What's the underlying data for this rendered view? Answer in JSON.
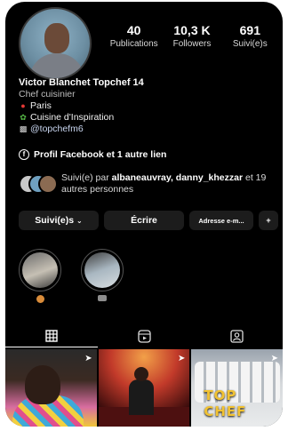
{
  "profile": {
    "name": "Victor Blanchet Topchef 14",
    "category": "Chef cuisinier",
    "location": "Paris",
    "tagline": "Cuisine d'Inspiration",
    "handle": "@topchefm6"
  },
  "stats": [
    {
      "value": "40",
      "label": "Publications"
    },
    {
      "value": "10,3 K",
      "label": "Followers"
    },
    {
      "value": "691",
      "label": "Suivi(e)s"
    }
  ],
  "links": {
    "facebook": "Profil Facebook et 1 autre lien"
  },
  "followed_by": {
    "prefix": "Suivi(e) par ",
    "names": "albaneauvray, danny_khezzar",
    "suffix": " et 19 autres personnes"
  },
  "actions": {
    "follow_label": "Suivi(e)s",
    "write_label": "Écrire",
    "email_label": "Adresse e-m...",
    "add_label": "+"
  },
  "tiles": {
    "logo_text": "TOP CHEF"
  },
  "colors": {
    "background": "#000000",
    "button_bg": "#1c1c1c",
    "text": "#ffffff",
    "secondary_text": "#bdbdbd"
  },
  "icons": {
    "location": "pin-icon",
    "tagline": "seedling-icon",
    "handle": "chef-icon",
    "facebook": "facebook-icon"
  }
}
